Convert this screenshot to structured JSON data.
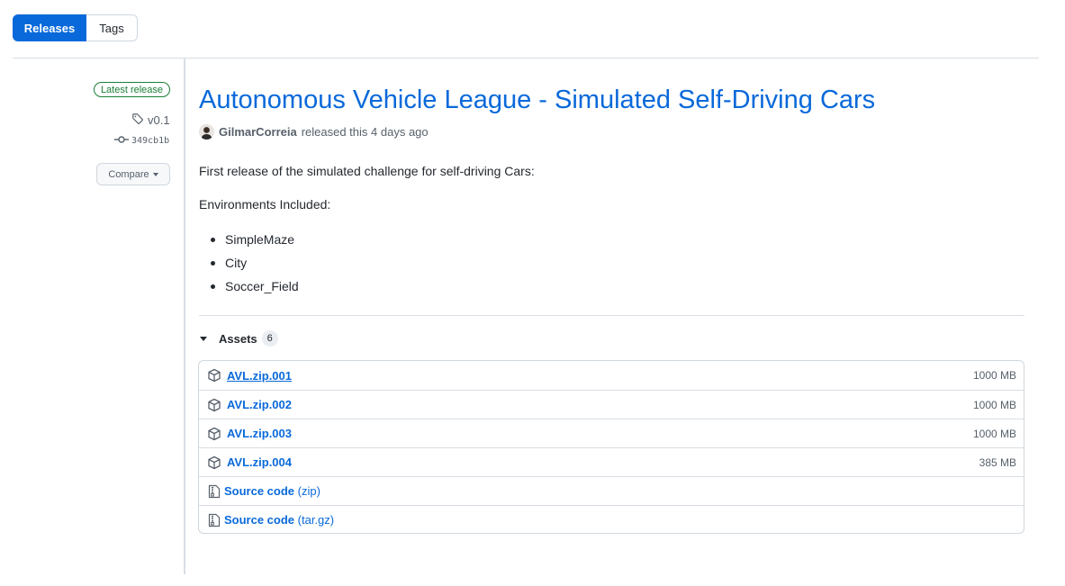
{
  "tabs": {
    "releases": "Releases",
    "tags": "Tags"
  },
  "meta": {
    "latest_badge": "Latest release",
    "tag": "v0.1",
    "commit": "349cb1b",
    "compare": "Compare"
  },
  "release": {
    "title": "Autonomous Vehicle League - Simulated Self-Driving Cars",
    "author": "GilmarCorreia",
    "released_text": "released this 4 days ago",
    "description": "First release of the simulated challenge for self-driving Cars:",
    "environments_heading": "Environments Included:",
    "environments": [
      "SimpleMaze",
      "City",
      "Soccer_Field"
    ]
  },
  "assets": {
    "label": "Assets",
    "count": "6",
    "files": [
      {
        "name": "AVL.zip.001",
        "size": "1000 MB"
      },
      {
        "name": "AVL.zip.002",
        "size": "1000 MB"
      },
      {
        "name": "AVL.zip.003",
        "size": "1000 MB"
      },
      {
        "name": "AVL.zip.004",
        "size": "385 MB"
      }
    ],
    "sources": [
      {
        "name": "Source code",
        "suffix": "(zip)"
      },
      {
        "name": "Source code",
        "suffix": "(tar.gz)"
      }
    ]
  },
  "colors": {
    "accent": "#0969da",
    "latest_green": "#1a7f37",
    "muted": "#57606a"
  }
}
